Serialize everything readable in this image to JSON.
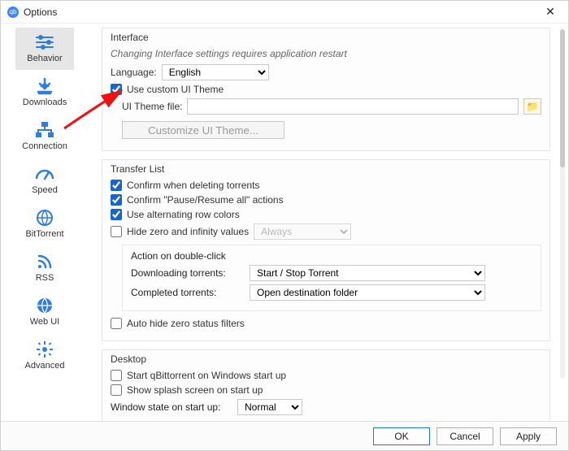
{
  "window": {
    "title": "Options"
  },
  "sidebar": {
    "items": [
      {
        "label": "Behavior"
      },
      {
        "label": "Downloads"
      },
      {
        "label": "Connection"
      },
      {
        "label": "Speed"
      },
      {
        "label": "BitTorrent"
      },
      {
        "label": "RSS"
      },
      {
        "label": "Web UI"
      },
      {
        "label": "Advanced"
      }
    ]
  },
  "interface": {
    "legend": "Interface",
    "hint": "Changing Interface settings requires application restart",
    "language_label": "Language:",
    "language_value": "English",
    "use_custom_theme": "Use custom UI Theme",
    "theme_file_label": "UI Theme file:",
    "theme_file_value": "",
    "customize_btn": "Customize UI Theme..."
  },
  "transfer": {
    "legend": "Transfer List",
    "confirm_delete": "Confirm when deleting torrents",
    "confirm_pause": "Confirm \"Pause/Resume all\" actions",
    "alt_rows": "Use alternating row colors",
    "hide_zero": "Hide zero and infinity values",
    "hide_zero_mode": "Always",
    "dblclick_legend": "Action on double-click",
    "downloading_label": "Downloading torrents:",
    "downloading_value": "Start / Stop Torrent",
    "completed_label": "Completed torrents:",
    "completed_value": "Open destination folder",
    "auto_hide_status": "Auto hide zero status filters"
  },
  "desktop": {
    "legend": "Desktop",
    "start_windows": "Start qBittorrent on Windows start up",
    "splash": "Show splash screen on start up",
    "winstate_label": "Window state on start up:",
    "winstate_value": "Normal"
  },
  "footer": {
    "ok": "OK",
    "cancel": "Cancel",
    "apply": "Apply"
  }
}
